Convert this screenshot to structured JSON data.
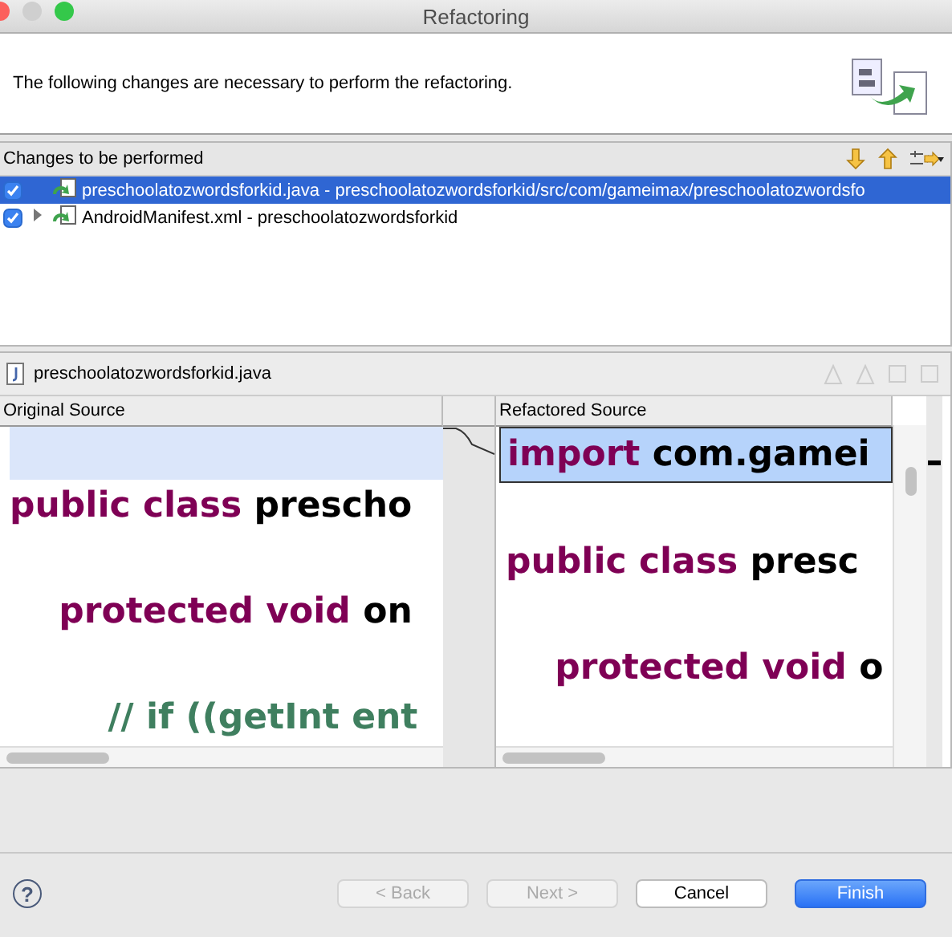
{
  "window": {
    "title": "Refactoring"
  },
  "header": {
    "description": "The following changes are necessary to perform the refactoring."
  },
  "changes": {
    "title": "Changes to be performed",
    "items": [
      {
        "label": "preschoolatozwordsforkid.java - preschoolatozwordsforkid/src/com/gameimax/preschoolatozwordsfo",
        "checked": true,
        "selected": true,
        "expandable": false
      },
      {
        "label": "AndroidManifest.xml - preschoolatozwordsforkid",
        "checked": true,
        "selected": false,
        "expandable": true
      }
    ]
  },
  "compare": {
    "file": "preschoolatozwordsforkid.java",
    "original": {
      "title": "Original Source",
      "lines": [
        {
          "highlighted": true
        },
        {
          "highlighted": false,
          "tokens": [
            {
              "kind": "keyword",
              "text": "public class "
            },
            {
              "kind": "plain",
              "text": "prescho"
            }
          ]
        },
        {
          "highlighted": false,
          "tokens": [
            {
              "kind": "keyword",
              "text": "    protected void "
            },
            {
              "kind": "plain",
              "text": "on"
            }
          ]
        },
        {
          "highlighted": false,
          "tokens": [
            {
              "kind": "comment",
              "text": "        // if ((getInt ent"
            }
          ]
        }
      ]
    },
    "refactored": {
      "title": "Refactored Source",
      "lines": [
        {
          "highlighted": true,
          "tokens": [
            {
              "kind": "keyword",
              "text": "import "
            },
            {
              "kind": "plain",
              "text": "com.gamei"
            }
          ]
        },
        {
          "highlighted": false,
          "tokens": [
            {
              "kind": "keyword",
              "text": "public class "
            },
            {
              "kind": "plain",
              "text": "presc"
            }
          ]
        },
        {
          "highlighted": false,
          "tokens": [
            {
              "kind": "keyword",
              "text": "    protected void "
            },
            {
              "kind": "plain",
              "text": "o"
            }
          ]
        }
      ]
    }
  },
  "help": "?",
  "buttons": [
    {
      "label": "< Back",
      "disabled": true,
      "default": false
    },
    {
      "label": "Next >",
      "disabled": true,
      "default": false
    },
    {
      "label": "Cancel",
      "disabled": false,
      "default": false
    },
    {
      "label": "Finish",
      "disabled": false,
      "default": true
    }
  ]
}
